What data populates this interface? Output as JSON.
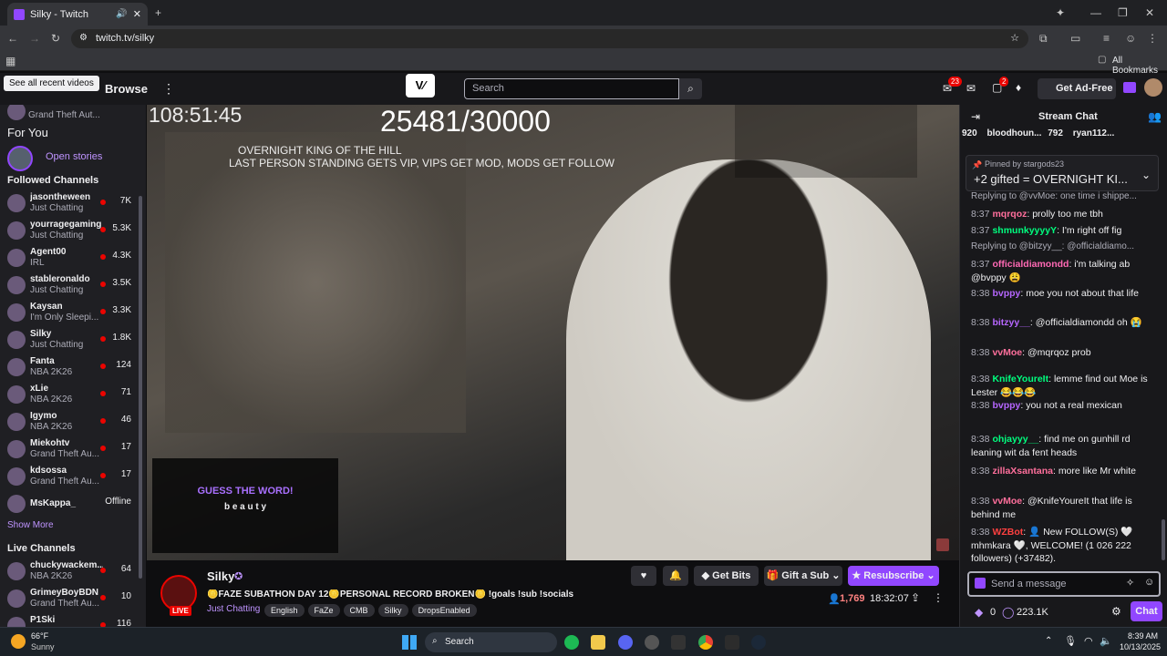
{
  "browser": {
    "tab_title": "Silky - Twitch",
    "url": "twitch.tv/silky",
    "all_bookmarks": "All Bookmarks",
    "tooltip": "See all recent videos"
  },
  "nav": {
    "browse": "Browse",
    "search_placeholder": "Search",
    "get_ad_free": "Get Ad-Free",
    "inbox_badge": "23",
    "whispers_badge": "2"
  },
  "sidebar": {
    "top_game": "Grand Theft Aut...",
    "for_you": "For You",
    "open_stories": "Open stories",
    "followed_title": "Followed Channels",
    "followed": [
      {
        "name": "jasontheween",
        "game": "Just Chatting",
        "viewers": "7K"
      },
      {
        "name": "yourragegaming",
        "game": "Just Chatting",
        "viewers": "5.3K"
      },
      {
        "name": "Agent00",
        "game": "IRL",
        "viewers": "4.3K"
      },
      {
        "name": "stableronaldo",
        "game": "Just Chatting",
        "viewers": "3.5K"
      },
      {
        "name": "Kaysan",
        "game": "I'm Only Sleepi...",
        "viewers": "3.3K"
      },
      {
        "name": "Silky",
        "game": "Just Chatting",
        "viewers": "1.8K"
      },
      {
        "name": "Fanta",
        "game": "NBA 2K26",
        "viewers": "124"
      },
      {
        "name": "xLie",
        "game": "NBA 2K26",
        "viewers": "71"
      },
      {
        "name": "Igymo",
        "game": "NBA 2K26",
        "viewers": "46"
      },
      {
        "name": "Miekohtv",
        "game": "Grand Theft Au...",
        "viewers": "17"
      },
      {
        "name": "kdsossa",
        "game": "Grand Theft Au...",
        "viewers": "17"
      },
      {
        "name": "MsKappa_",
        "game": "",
        "viewers": "Offline"
      }
    ],
    "show_more": "Show More",
    "live_title": "Live Channels",
    "live": [
      {
        "name": "chuckywackem...",
        "game": "NBA 2K26",
        "viewers": "64"
      },
      {
        "name": "GrimeyBoyBDN",
        "game": "Grand Theft Au...",
        "viewers": "10"
      },
      {
        "name": "P1Ski",
        "game": "",
        "viewers": "116"
      }
    ]
  },
  "video": {
    "timer": "108:51:45",
    "sub_count": "25481/30000",
    "overlay_line1": "OVERNIGHT KING OF THE HILL",
    "overlay_line2": "LAST PERSON STANDING GETS VIP, VIPS GET MOD, MODS GET FOLLOW",
    "guess_title": "GUESS THE WORD!",
    "guess_word": "b e a u t y"
  },
  "stream": {
    "channel": "Silky",
    "live_label": "LIVE",
    "title": "🪙FAZE SUBATHON DAY 12🪙PERSONAL RECORD BROKEN🪙 !goals !sub !socials",
    "category": "Just Chatting",
    "tags": [
      "English",
      "FaZe",
      "CMB",
      "Silky",
      "DropsEnabled"
    ],
    "viewers": "1,769",
    "uptime": "18:32:07",
    "get_bits": "Get Bits",
    "gift_sub": "Gift a Sub",
    "resubscribe": "Resubscribe"
  },
  "chat": {
    "title": "Stream Chat",
    "leaders": [
      {
        "rank": "920",
        "name": ""
      },
      {
        "name": "bloodhoun...",
        "value": "792"
      },
      {
        "name": "ryan112..."
      }
    ],
    "pinned_by": "Pinned by stargods23",
    "pinned_text": "+2 gifted = OVERNIGHT KI...",
    "messages": [
      {
        "reply": "Replying to @vvMoe: one time i shippe..."
      },
      {
        "time": "8:37",
        "user": "mqrqoz",
        "color": "#ff6f9c",
        "text": "prolly too me tbh"
      },
      {
        "time": "8:37",
        "user": "shmunkyyyyY",
        "color": "#00ff7f",
        "text": "I'm right off fig"
      },
      {
        "reply": "Replying to @bitzyy__: @officialdiamo..."
      },
      {
        "time": "8:37",
        "user": "officialdiamondd",
        "color": "#ff69b4",
        "text": "i'm talking ab @bvppy 😩"
      },
      {
        "time": "8:38",
        "user": "bvppy",
        "color": "#b666ff",
        "text": "moe you not about that life"
      },
      {
        "time": "8:38",
        "user": "bitzyy__",
        "color": "#b666ff",
        "text": "@officialdiamondd oh 😭"
      },
      {
        "time": "8:38",
        "user": "vvMoe",
        "color": "#ff6f9c",
        "text": "@mqrqoz prob"
      },
      {
        "time": "8:38",
        "user": "KnifeYoureIt",
        "color": "#00ff7f",
        "text": "lemme find out Moe is Lester 😂😂😂"
      },
      {
        "time": "8:38",
        "user": "bvppy",
        "color": "#b666ff",
        "text": "you not a real mexican"
      },
      {
        "time": "8:38",
        "user": "ohjayyy__",
        "color": "#00ff7f",
        "text": "find me on gunhill rd leaning wit da fent heads"
      },
      {
        "time": "8:38",
        "user": "zillaXsantana",
        "color": "#ff6f9c",
        "text": "more like Mr white"
      },
      {
        "time": "8:38",
        "user": "vvMoe",
        "color": "#ff6f9c",
        "text": "@KnifeYoureIt that life is behind me"
      },
      {
        "time": "8:38",
        "user": "WZBot",
        "color": "#ff4040",
        "text": "👤 New FOLLOW(S) 🤍 mhmkara 🤍, WELCOME! (1 026 222 followers) (+37482)."
      }
    ],
    "input_placeholder": "Send a message",
    "bits": "0",
    "points": "223.1K",
    "chat_button": "Chat"
  },
  "taskbar": {
    "weather_temp": "66°F",
    "weather_desc": "Sunny",
    "search": "Search",
    "time": "8:39 AM",
    "date": "10/13/2025"
  },
  "colors": {
    "twitch_purple": "#9147ff",
    "live_red": "#eb0400"
  }
}
